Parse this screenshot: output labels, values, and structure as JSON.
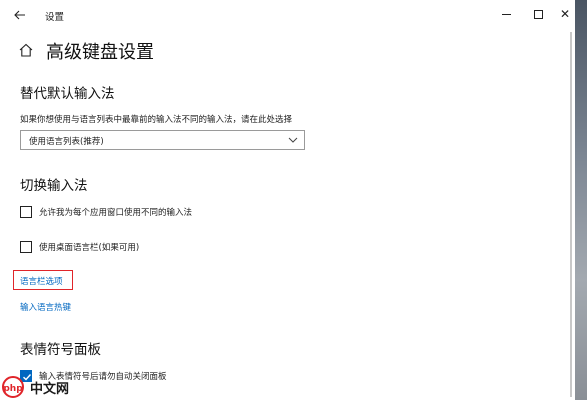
{
  "window": {
    "title": "设置",
    "back_icon": "arrow-left-icon",
    "controls": [
      "minimize-icon",
      "maximize-icon",
      "close-icon"
    ]
  },
  "page": {
    "title": "高级键盘设置",
    "home_icon": "home-icon"
  },
  "default_input": {
    "heading": "替代默认输入法",
    "description": "如果你想使用与语言列表中最靠前的输入法不同的输入法，请在此处选择",
    "select_value": "使用语言列表(推荐)"
  },
  "switch_input": {
    "heading": "切换输入法",
    "options": [
      {
        "label": "允许我为每个应用窗口使用不同的输入法",
        "checked": false
      },
      {
        "label": "使用桌面语言栏(如果可用)",
        "checked": false
      }
    ],
    "links": [
      "语言栏选项",
      "输入语言热键"
    ],
    "highlight_color": "#e0252a"
  },
  "emoji_panel": {
    "heading": "表情符号面板",
    "option": {
      "label": "输入表情符号后请勿自动关闭面板",
      "checked": true
    }
  },
  "colors": {
    "accent": "#0067c0"
  },
  "watermark": {
    "text": "中文网"
  }
}
